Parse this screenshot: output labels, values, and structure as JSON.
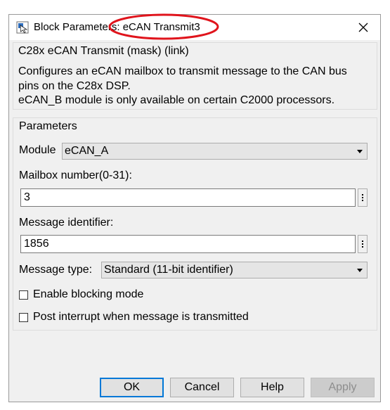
{
  "window": {
    "title": "Block Parameters: eCAN Transmit3",
    "icon": "simulink-block-icon",
    "annotation_color": "#e0141c"
  },
  "mask": {
    "title": "C28x eCAN Transmit (mask) (link)",
    "description_lines": [
      "Configures an eCAN mailbox to transmit message to the CAN bus",
      "pins on the C28x DSP.",
      "eCAN_B module is only available on certain C2000 processors."
    ]
  },
  "parameters": {
    "title": "Parameters",
    "module": {
      "label": "Module",
      "value": "eCAN_A"
    },
    "mailbox": {
      "label": "Mailbox number(0-31):",
      "value": "3"
    },
    "identifier": {
      "label": "Message identifier:",
      "value": "1856"
    },
    "message_type": {
      "label": "Message type:",
      "value": "Standard (11-bit identifier)"
    },
    "blocking": {
      "label": "Enable blocking mode",
      "checked": false
    },
    "interrupt": {
      "label": "Post interrupt when message is transmitted",
      "checked": false
    }
  },
  "buttons": {
    "ok": "OK",
    "cancel": "Cancel",
    "help": "Help",
    "apply": "Apply"
  },
  "colors": {
    "default_button_border": "#0078d7",
    "dialog_background": "#f0f0f0"
  }
}
